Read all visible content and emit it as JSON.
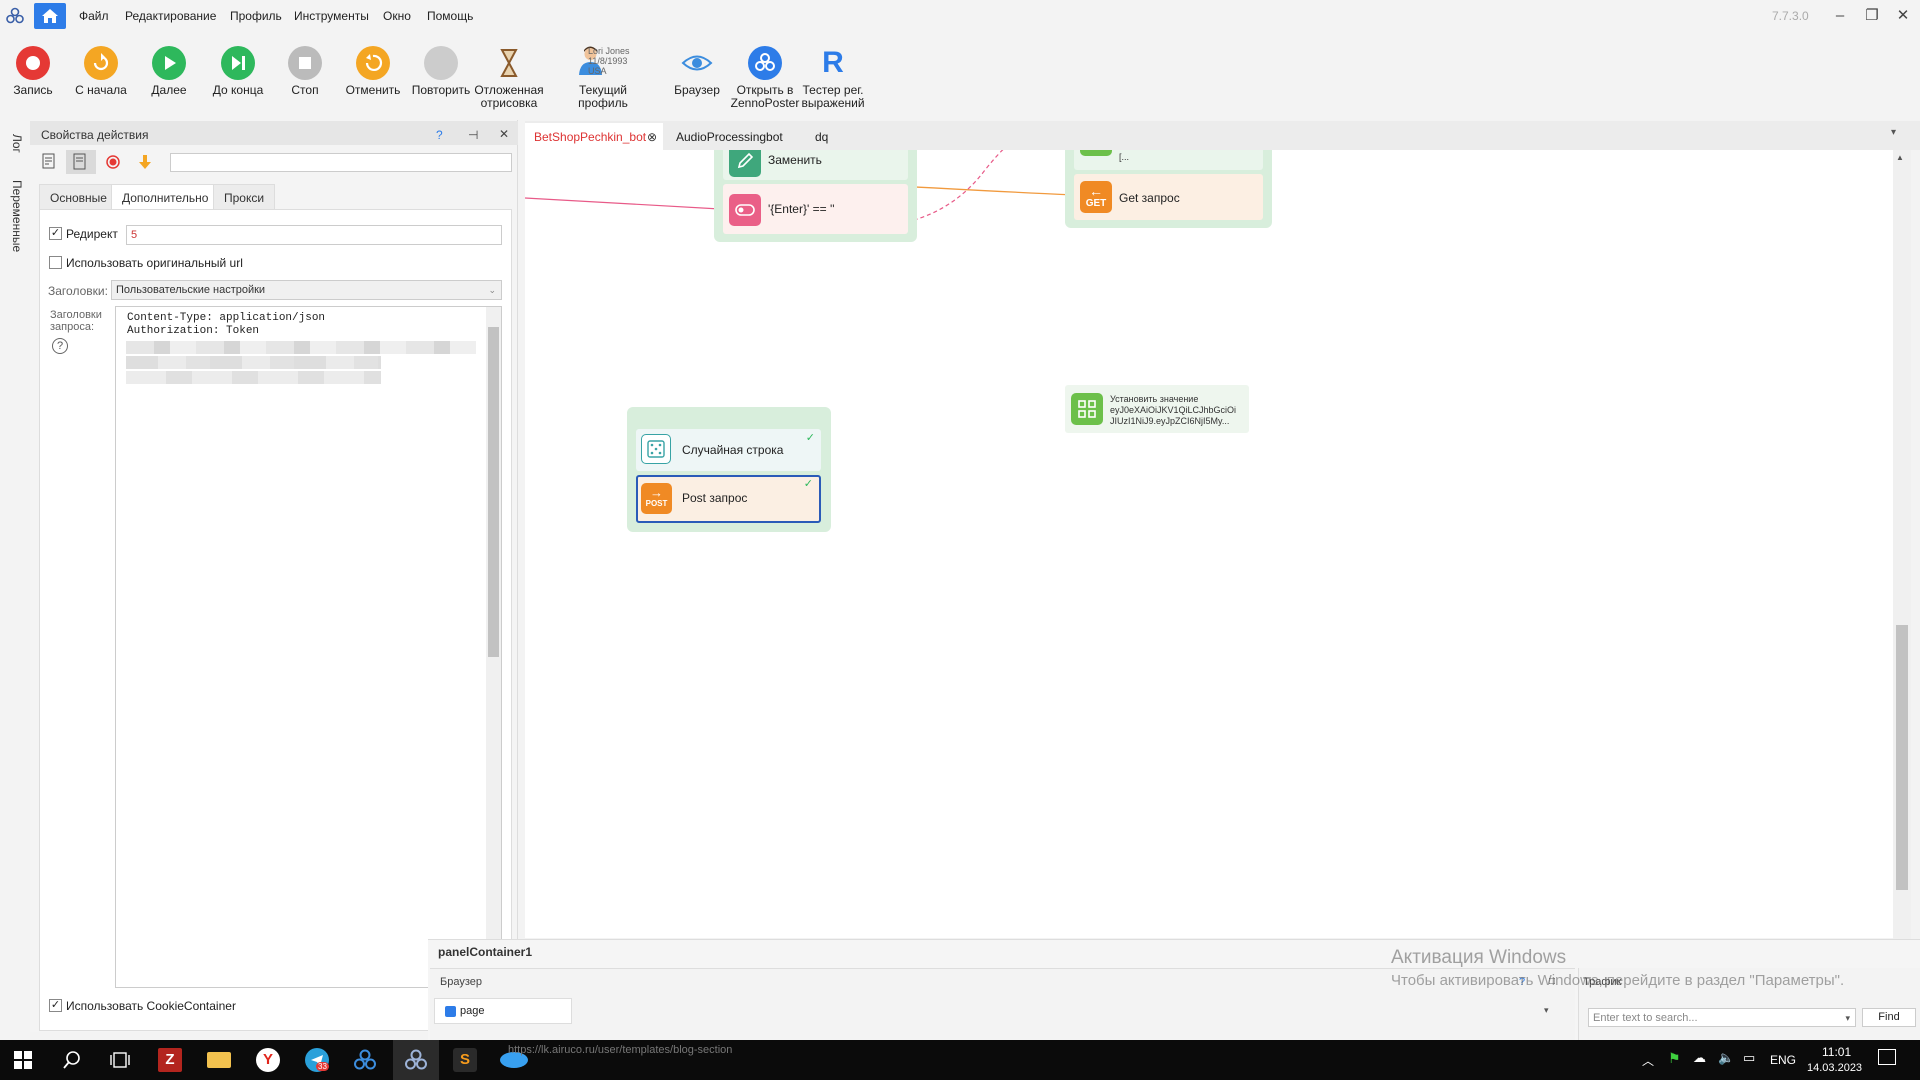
{
  "app": {
    "version": "7.7.3.0"
  },
  "menu": [
    "Файл",
    "Редактирование",
    "Профиль",
    "Инструменты",
    "Окно",
    "Помощь"
  ],
  "toolbar": [
    {
      "label": "Запись",
      "icon": "record-icon",
      "color": "#e53935"
    },
    {
      "label": "С начала",
      "icon": "restart-icon",
      "color": "#f4a623"
    },
    {
      "label": "Далее",
      "icon": "play-icon",
      "color": "#2eb85c"
    },
    {
      "label": "До конца",
      "icon": "skip-end-icon",
      "color": "#2eb85c"
    },
    {
      "label": "Стоп",
      "icon": "stop-icon",
      "color": "#bbbbbb"
    },
    {
      "label": "Отменить",
      "icon": "undo-icon",
      "color": "#f4a623"
    },
    {
      "label": "Повторить",
      "icon": "redo-icon",
      "color": "#cccccc"
    },
    {
      "label": "Отложенная\nотрисовка",
      "icon": "hourglass-icon",
      "color": "#c88a3a"
    },
    {
      "label": "Текущий профиль",
      "icon": "profile-icon",
      "color": "#3c8dde"
    },
    {
      "label": "Браузер",
      "icon": "eye-icon",
      "color": "#3c8dde"
    },
    {
      "label": "Открыть в\nZennoPoster",
      "icon": "zennoposter-icon",
      "color": "#2d7ce8"
    },
    {
      "label": "Тестер рег.\nвыражений",
      "icon": "regex-icon",
      "color": "#2d7ce8"
    }
  ],
  "profile_card": {
    "name": "Lori Jones",
    "date": "11/8/1993",
    "country": "USA"
  },
  "sidebar": {
    "log": "Лог",
    "variables": "Переменные"
  },
  "props": {
    "title": "Свойства действия",
    "help": "?",
    "pin": "⊣",
    "close": "✕",
    "tabs": [
      "Основные",
      "Дополнительно",
      "Прокси"
    ],
    "redirect_label": "Редирект",
    "redirect_value": "5",
    "orig_url_label": "Использовать оригинальный url",
    "headers_label": "Заголовки:",
    "headers_value": "Пользовательские настройки",
    "req_headers_label": "Заголовки\nзапроса:",
    "headers_text": "Content-Type: application/json\nAuthorization: Token",
    "cookie_label": "Использовать CookieContainer"
  },
  "doc_tabs": [
    "BetShopPechkin_bot",
    "AudioProcessingbot",
    "dq"
  ],
  "nodes": {
    "replace": "Заменить",
    "condition": "'{Enter}' == ''",
    "get": "Get запрос",
    "get_badge": "GET",
    "setval_title": "Установить значение",
    "setval_l1": "eyJ0eXAiOiJKV1QiLCJhbGciOi",
    "setval_l2": "JIUzI1NiJ9.eyJpZCI6NjI5My...",
    "top_small": "[...",
    "random": "Случайная строка",
    "post": "Post запрос",
    "post_badge": "POST"
  },
  "bottom": {
    "container": "panelContainer1",
    "browser": "Браузер",
    "page_tab": "page",
    "url": "https://lk.airuco.ru/user/templates/blog-section",
    "traffic": "Трафик",
    "search_placeholder": "Enter text to search...",
    "find": "Find",
    "question": "?"
  },
  "activation": {
    "title": "Активация Windows",
    "text": "Чтобы активировать Windows, перейдите в раздел \"Параметры\"."
  },
  "taskbar": {
    "lang": "ENG",
    "time": "11:01",
    "date": "14.03.2023",
    "telegram_badge": "33"
  }
}
